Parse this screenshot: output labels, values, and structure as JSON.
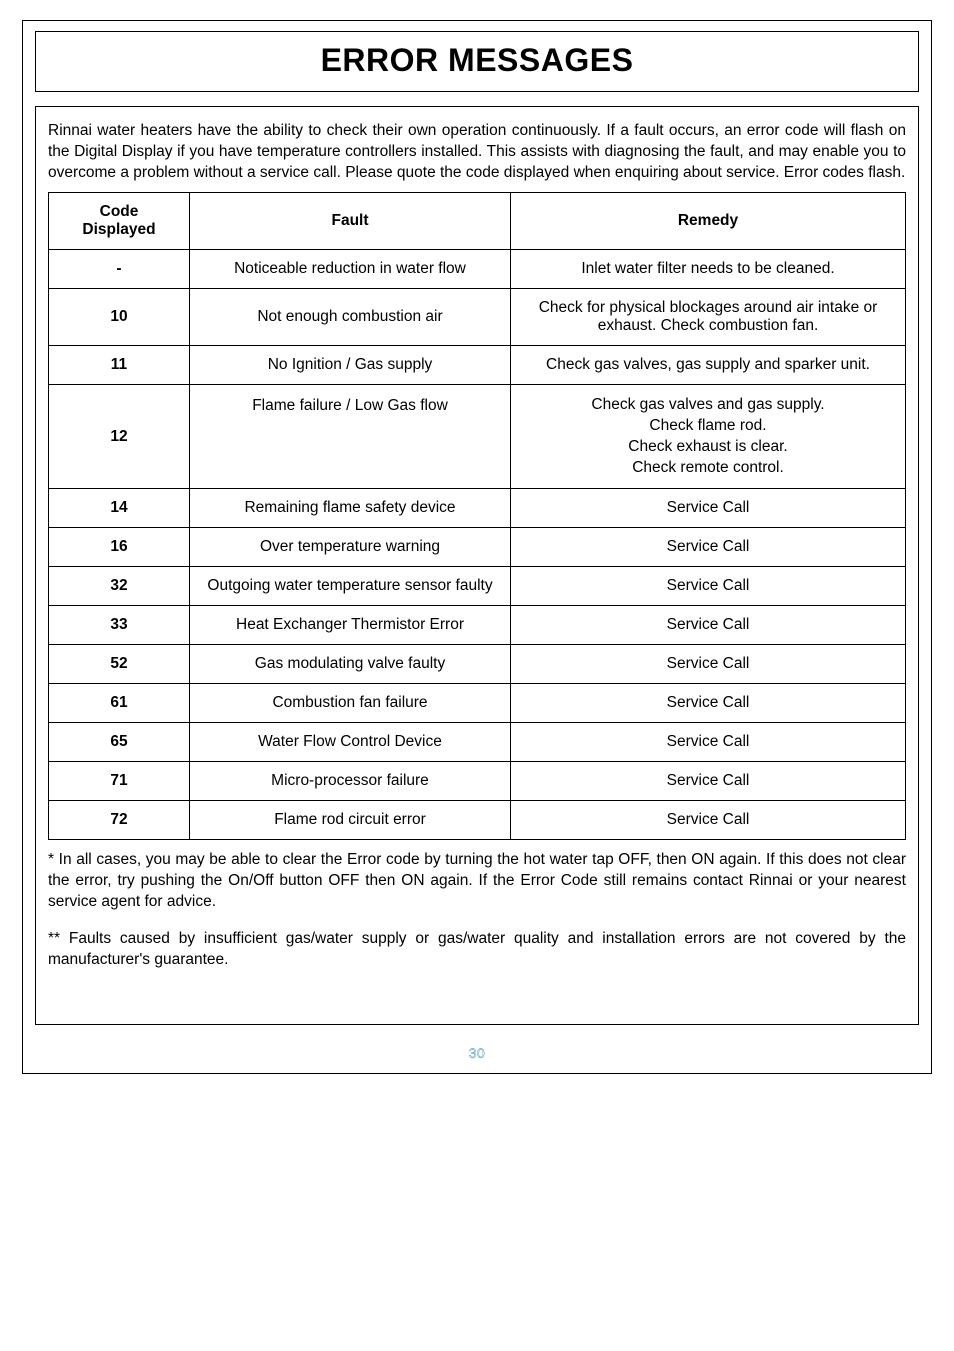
{
  "title": "ERROR MESSAGES",
  "intro": "Rinnai water heaters have the ability to check their own operation continuously. If a fault occurs, an error code will flash on the Digital Display if you have temperature controllers installed. This assists with diagnosing the fault, and may enable you to overcome a problem without a service call. Please quote the code displayed when enquiring about service. Error codes flash.",
  "table": {
    "headers": {
      "code": "Code Displayed",
      "fault": "Fault",
      "remedy": "Remedy"
    },
    "rows": [
      {
        "code": "-",
        "fault": "Noticeable reduction in water flow",
        "remedy": "Inlet water filter needs to be cleaned."
      },
      {
        "code": "10",
        "fault": "Not enough combustion air",
        "remedy": "Check for physical blockages around air intake or exhaust.  Check combustion fan."
      },
      {
        "code": "11",
        "fault": "No Ignition / Gas supply",
        "remedy": "Check gas valves, gas supply and sparker unit."
      },
      {
        "code": "12",
        "fault": "Flame failure / Low Gas flow",
        "remedy": "Check gas valves and gas supply.\nCheck flame rod.\nCheck exhaust is clear.\nCheck remote control."
      },
      {
        "code": "14",
        "fault": "Remaining flame safety device",
        "remedy": "Service Call"
      },
      {
        "code": "16",
        "fault": "Over temperature warning",
        "remedy": "Service Call"
      },
      {
        "code": "32",
        "fault": "Outgoing water temperature sensor faulty",
        "remedy": "Service Call"
      },
      {
        "code": "33",
        "fault": "Heat Exchanger Thermistor Error",
        "remedy": "Service Call"
      },
      {
        "code": "52",
        "fault": "Gas modulating valve faulty",
        "remedy": "Service Call"
      },
      {
        "code": "61",
        "fault": "Combustion fan failure",
        "remedy": "Service Call"
      },
      {
        "code": "65",
        "fault": "Water Flow Control Device",
        "remedy": "Service Call"
      },
      {
        "code": "71",
        "fault": "Micro-processor failure",
        "remedy": "Service Call"
      },
      {
        "code": "72",
        "fault": "Flame rod circuit error",
        "remedy": "Service Call"
      }
    ]
  },
  "footnote1": "* In all cases, you may be able to clear the Error code by turning the hot water tap OFF, then ON again. If this does not clear the error, try pushing the On/Off button OFF then ON again. If the Error Code still remains contact Rinnai or your nearest service agent for advice.",
  "footnote2": "** Faults caused by insufficient gas/water supply or gas/water quality and installation errors are not covered by the manufacturer's guarantee.",
  "page_number": "30"
}
